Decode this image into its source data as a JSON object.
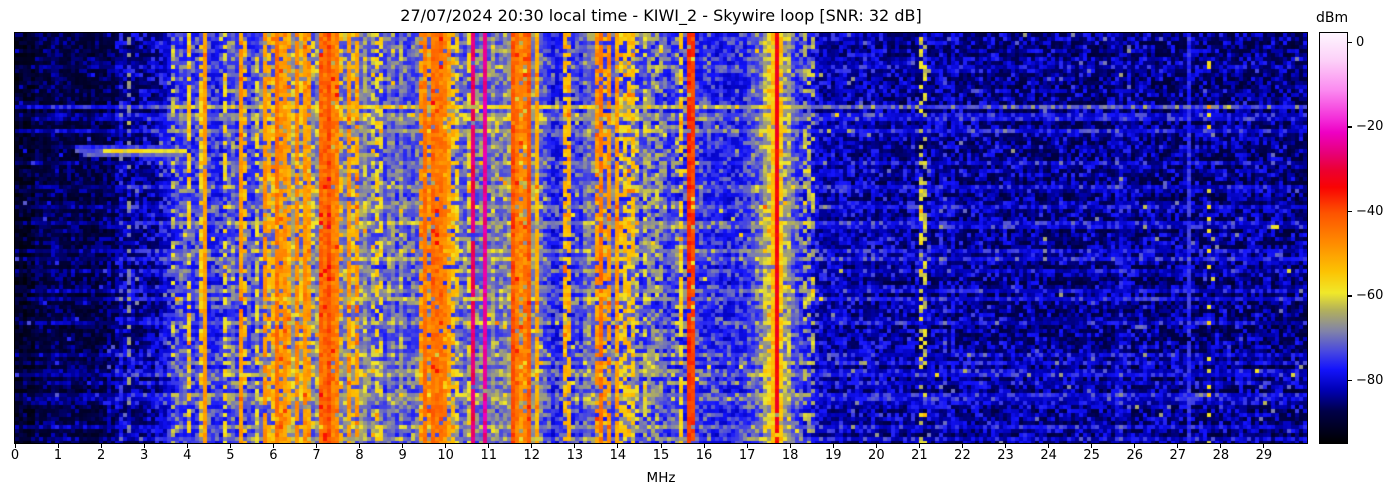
{
  "chart_data": {
    "type": "heatmap",
    "subtype": "radio-spectrogram-waterfall",
    "title": "27/07/2024 20:30 local time - KIWI_2 - Skywire loop [SNR: 32 dB]",
    "xlabel": "MHz",
    "x_range": [
      0,
      30
    ],
    "x_ticks": [
      0,
      1,
      2,
      3,
      4,
      5,
      6,
      7,
      8,
      9,
      10,
      11,
      12,
      13,
      14,
      15,
      16,
      17,
      18,
      19,
      20,
      21,
      22,
      23,
      24,
      25,
      26,
      27,
      28,
      29
    ],
    "y_ticks": [],
    "colorbar": {
      "label": "dBm",
      "ticks": [
        0,
        -20,
        -40,
        -60,
        -80
      ],
      "vmax": 2.5,
      "vmin": -94.5
    },
    "colormap_stops": [
      [
        -94.5,
        "#000000"
      ],
      [
        -87,
        "#000048"
      ],
      [
        -82,
        "#0000b4"
      ],
      [
        -77,
        "#1414fc"
      ],
      [
        -73,
        "#4646e2"
      ],
      [
        -68,
        "#8183a8"
      ],
      [
        -63,
        "#b3b15a"
      ],
      [
        -59,
        "#f0e82a"
      ],
      [
        -54,
        "#fcc303"
      ],
      [
        -47,
        "#ff8a00"
      ],
      [
        -40,
        "#fd5200"
      ],
      [
        -34,
        "#f90303"
      ],
      [
        -30,
        "#ec0030"
      ],
      [
        -26,
        "#e70077"
      ],
      [
        -21,
        "#ee00c4"
      ],
      [
        -18,
        "#f32ad8"
      ],
      [
        -11,
        "#fb8af0"
      ],
      [
        -4,
        "#fcd0f8"
      ],
      [
        2.5,
        "#fef6ff"
      ]
    ],
    "noise_floor_db": [
      [
        0,
        -91
      ],
      [
        2.2,
        -91
      ],
      [
        2.45,
        -89
      ],
      [
        3.3,
        -87.5
      ],
      [
        3.6,
        -83
      ],
      [
        3.8,
        -79.5
      ],
      [
        4.7,
        -81
      ],
      [
        5.6,
        -79
      ],
      [
        5.85,
        -75.5
      ],
      [
        8.2,
        -75.5
      ],
      [
        8.7,
        -79
      ],
      [
        9.35,
        -77
      ],
      [
        12.1,
        -76
      ],
      [
        12.5,
        -82
      ],
      [
        13.2,
        -81
      ],
      [
        13.4,
        -78
      ],
      [
        14.5,
        -78.5
      ],
      [
        15.1,
        -81
      ],
      [
        16.9,
        -83
      ],
      [
        17.6,
        -79
      ],
      [
        18.2,
        -82
      ],
      [
        18.7,
        -86.5
      ],
      [
        19.6,
        -87.5
      ],
      [
        21,
        -88
      ],
      [
        24,
        -88.5
      ],
      [
        27,
        -89
      ],
      [
        30,
        -89.5
      ]
    ],
    "bands": [
      {
        "f0": 2.63,
        "f1": 2.71,
        "level": -66,
        "duty": 0.55
      },
      {
        "f0": 3.58,
        "f1": 3.68,
        "level": -60,
        "duty": 0.4
      },
      {
        "f0": 3.86,
        "f1": 3.93,
        "level": -66,
        "duty": 0.45
      },
      {
        "f0": 3.98,
        "f1": 4.06,
        "level": -58,
        "duty": 0.5
      },
      {
        "f0": 4.3,
        "f1": 4.5,
        "level": -53,
        "duty": 0.8
      },
      {
        "f0": 4.8,
        "f1": 4.94,
        "level": -61,
        "duty": 0.4
      },
      {
        "f0": 5.22,
        "f1": 5.36,
        "level": -51,
        "duty": 0.7
      },
      {
        "f0": 5.55,
        "f1": 5.65,
        "level": -63,
        "duty": 0.4
      },
      {
        "f0": 5.82,
        "f1": 6.45,
        "level": -50,
        "duty": 0.75
      },
      {
        "f0": 6.5,
        "f1": 6.92,
        "level": -53,
        "duty": 0.6
      },
      {
        "f0": 7.1,
        "f1": 7.38,
        "level": -44,
        "duty": 0.9
      },
      {
        "f0": 7.38,
        "f1": 7.6,
        "level": -49,
        "duty": 0.75
      },
      {
        "f0": 7.68,
        "f1": 7.98,
        "level": -51,
        "duty": 0.7
      },
      {
        "f0": 8.28,
        "f1": 8.52,
        "level": -57,
        "duty": 0.5
      },
      {
        "f0": 9.38,
        "f1": 9.92,
        "level": -47,
        "duty": 0.8
      },
      {
        "f0": 9.95,
        "f1": 10.35,
        "level": -55,
        "duty": 0.55
      },
      {
        "f0": 10.48,
        "f1": 10.72,
        "level": -62,
        "duty": 0.4
      },
      {
        "f0": 11.55,
        "f1": 12.02,
        "level": -46,
        "duty": 0.85
      },
      {
        "f0": 12.05,
        "f1": 12.16,
        "level": -56,
        "duty": 0.5
      },
      {
        "f0": 12.75,
        "f1": 12.95,
        "level": -56,
        "duty": 0.5
      },
      {
        "f0": 13.48,
        "f1": 13.82,
        "level": -48,
        "duty": 0.75
      },
      {
        "f0": 13.95,
        "f1": 14.47,
        "level": -54,
        "duty": 0.6
      },
      {
        "f0": 14.6,
        "f1": 15.1,
        "level": -65,
        "duty": 0.4
      },
      {
        "f0": 15.3,
        "f1": 15.47,
        "level": -60,
        "duty": 0.45
      },
      {
        "f0": 15.55,
        "f1": 15.82,
        "level": -62,
        "duty": 0.5
      },
      {
        "f0": 17.44,
        "f1": 17.62,
        "level": -58,
        "duty": 0.6
      },
      {
        "f0": 17.7,
        "f1": 17.88,
        "level": -58,
        "duty": 0.6
      },
      {
        "f0": 18.33,
        "f1": 18.62,
        "level": -64,
        "duty": 0.35
      },
      {
        "f0": 21.0,
        "f1": 21.14,
        "level": -63,
        "duty": 0.3
      },
      {
        "f0": 21.52,
        "f1": 21.66,
        "level": -68,
        "duty": 0.3
      },
      {
        "f0": 27.7,
        "f1": 27.82,
        "level": -60,
        "duty": 0.15
      }
    ],
    "carriers": [
      {
        "f": 2.14,
        "level": -81,
        "duty": 0.5
      },
      {
        "f": 4.37,
        "level": -50,
        "duty": 0.9
      },
      {
        "f": 5.29,
        "level": -49,
        "duty": 0.85
      },
      {
        "f": 5.76,
        "level": -48,
        "duty": 0.8
      },
      {
        "f": 6.07,
        "level": -44,
        "duty": 0.9
      },
      {
        "f": 6.52,
        "level": -47,
        "duty": 0.8
      },
      {
        "f": 7.26,
        "level": -41,
        "duty": 0.92
      },
      {
        "f": 9.52,
        "level": -44,
        "duty": 0.9
      },
      {
        "f": 10.0,
        "level": -46,
        "duty": 0.85
      },
      {
        "f": 10.66,
        "level": -27,
        "duty": 0.95
      },
      {
        "f": 10.87,
        "level": -24,
        "duty": 0.97
      },
      {
        "f": 11.57,
        "level": -40,
        "duty": 0.9
      },
      {
        "f": 11.96,
        "level": -41,
        "duty": 0.9
      },
      {
        "f": 12.1,
        "level": -52,
        "duty": 0.6
      },
      {
        "f": 13.57,
        "level": -44,
        "duty": 0.9
      },
      {
        "f": 15.63,
        "level": -37,
        "duty": 0.95
      },
      {
        "f": 15.74,
        "level": -39,
        "duty": 0.9
      },
      {
        "f": 17.66,
        "level": -33,
        "duty": 0.97
      },
      {
        "f": 19.22,
        "level": -80,
        "duty": 0.7
      },
      {
        "f": 19.66,
        "level": -80,
        "duty": 0.6
      },
      {
        "f": 21.78,
        "level": -79,
        "duty": 0.6
      },
      {
        "f": 27.26,
        "level": -75,
        "duty": 0.9
      },
      {
        "f": 28.5,
        "level": -80,
        "duty": 0.5
      }
    ],
    "glows": [
      {
        "center": 17.66,
        "sigma": 0.33,
        "amp": 9
      },
      {
        "center": 11.78,
        "sigma": 0.35,
        "amp": 3
      }
    ],
    "h_streaks": [
      {
        "y_frac": 0.075,
        "f0": 0,
        "f1": 30,
        "boost": 3.5
      },
      {
        "y_frac": 0.17,
        "f0": 0,
        "f1": 30,
        "boost": 6
      },
      {
        "y_frac": 0.235,
        "f0": 0,
        "f1": 30,
        "boost": 6.5
      },
      {
        "y_frac": 0.31,
        "f0": 0,
        "f1": 30,
        "boost": 3
      },
      {
        "y_frac": 0.415,
        "f0": 0,
        "f1": 30,
        "boost": 4
      },
      {
        "y_frac": 0.47,
        "f0": 14,
        "f1": 30,
        "boost": 4
      },
      {
        "y_frac": 0.52,
        "f0": 0,
        "f1": 30,
        "boost": 5
      },
      {
        "y_frac": 0.575,
        "f0": 0,
        "f1": 30,
        "boost": 3.5
      },
      {
        "y_frac": 0.62,
        "f0": 0,
        "f1": 30,
        "boost": 4.5
      },
      {
        "y_frac": 0.7,
        "f0": 0,
        "f1": 30,
        "boost": 4
      },
      {
        "y_frac": 0.78,
        "f0": 0,
        "f1": 30,
        "boost": 4.5
      },
      {
        "y_frac": 0.845,
        "f0": 0,
        "f1": 30,
        "boost": 3.5
      },
      {
        "y_frac": 0.88,
        "f0": 0,
        "f1": 30,
        "boost": 5
      },
      {
        "y_frac": 0.95,
        "f0": 0,
        "f1": 30,
        "boost": 4
      }
    ],
    "special_streak": {
      "y_frac": 0.285,
      "f0": 1.35,
      "f1": 4.0,
      "bright_from": 2.05,
      "level": -58
    },
    "seed": 42
  }
}
